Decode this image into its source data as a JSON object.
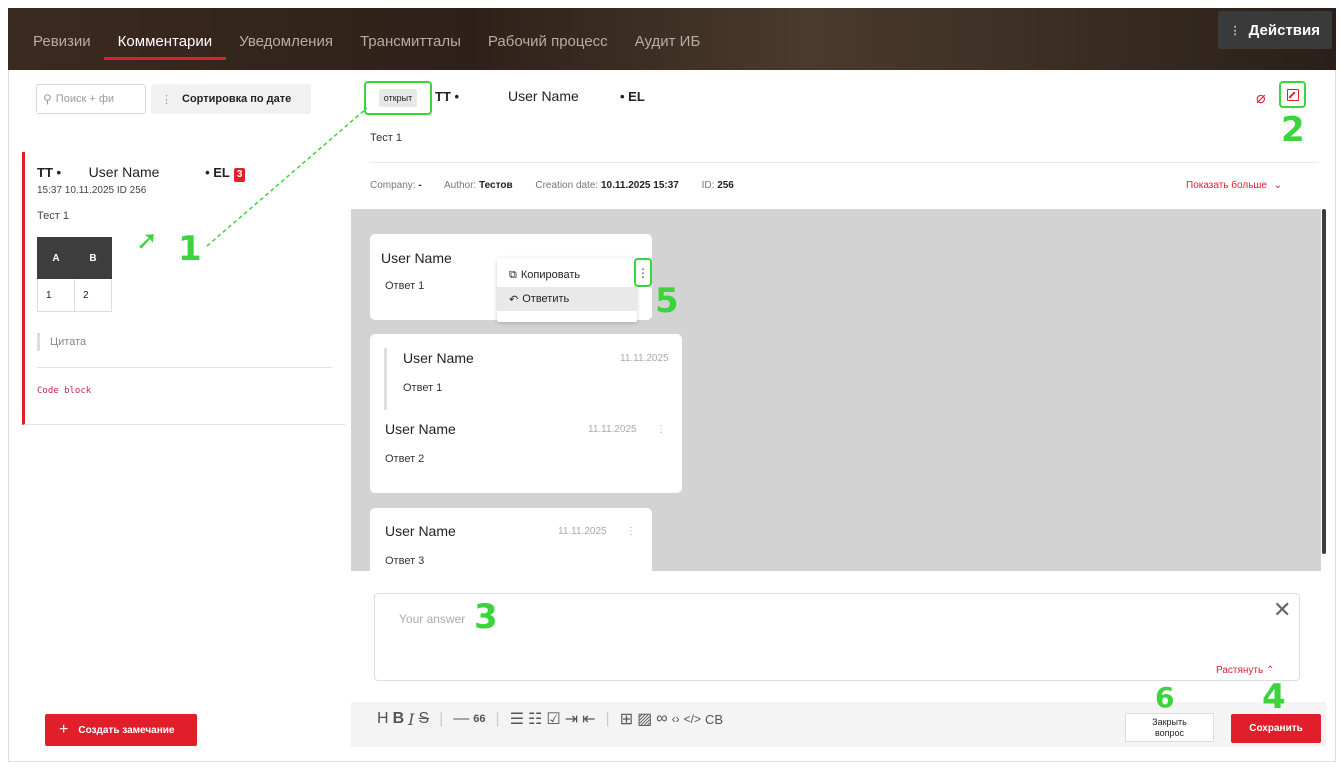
{
  "tabs": [
    {
      "label": "Ревизии",
      "active": false
    },
    {
      "label": "Комментарии",
      "active": true
    },
    {
      "label": "Уведомления",
      "active": false
    },
    {
      "label": "Трансмиттал",
      "active": false
    },
    {
      "label": "Рабочий процесс",
      "active": false
    },
    {
      "label": "Аудит ИБ",
      "active": false
    }
  ],
  "tabs_display": [
    "Ревизии",
    "Комментарии",
    "Уведомления",
    "Трансмитталы",
    "Рабочий процесс",
    "Аудит ИБ"
  ],
  "actions_label": "Действия",
  "search": {
    "placeholder": "Поиск + фи"
  },
  "sort_label": "Сортировка по дате",
  "card": {
    "tt": "TT •",
    "user": "User Name",
    "el": "• EL",
    "count": "3",
    "meta": "15:37 10.11.2025   ID 256",
    "text": "Тест 1",
    "table": {
      "headers": [
        "A",
        "B"
      ],
      "row": [
        "1",
        "2"
      ]
    },
    "quote": "Цитата",
    "code": "Code block"
  },
  "create_label": "Создать замечание",
  "header": {
    "status": "открыт",
    "tt": "TT •",
    "user": "User Name",
    "el": "• EL",
    "title": "Тест 1"
  },
  "meta": {
    "company_label": "Company:",
    "company": "-",
    "author_label": "Author:",
    "author": "Тестов",
    "date_label": "Creation date:",
    "date": "10.11.2025 15:37",
    "id_label": "ID:",
    "id": "256",
    "show_more": "Показать больше"
  },
  "messages": [
    {
      "name": "User Name",
      "text": "Ответ 1"
    },
    {
      "quote_name": "User Name",
      "quote_date": "11.11.2025",
      "quote_text": "Ответ 1",
      "name": "User Name",
      "date": "11.11.2025",
      "text": "Ответ 2"
    },
    {
      "name": "User Name",
      "date": "11.11.2025",
      "text": "Ответ 3"
    }
  ],
  "context_menu": {
    "copy": "Копировать",
    "reply": "Ответить"
  },
  "answer": {
    "placeholder": "Your answer",
    "stretch": "Растянуть"
  },
  "toolbar": {
    "h": "H",
    "b": "B",
    "i": "I",
    "s": "S",
    "hr": "—",
    "quote": "66",
    "cb": "CB"
  },
  "close_question": "Закрыть вопрос",
  "close_question_l1": "Закрыть",
  "close_question_l2": "вопрос",
  "save_label": "Сохранить",
  "annotations": [
    "1",
    "2",
    "3",
    "4",
    "5",
    "6"
  ],
  "colors": {
    "accent": "#e01f2b",
    "highlight": "#3cd43c"
  }
}
